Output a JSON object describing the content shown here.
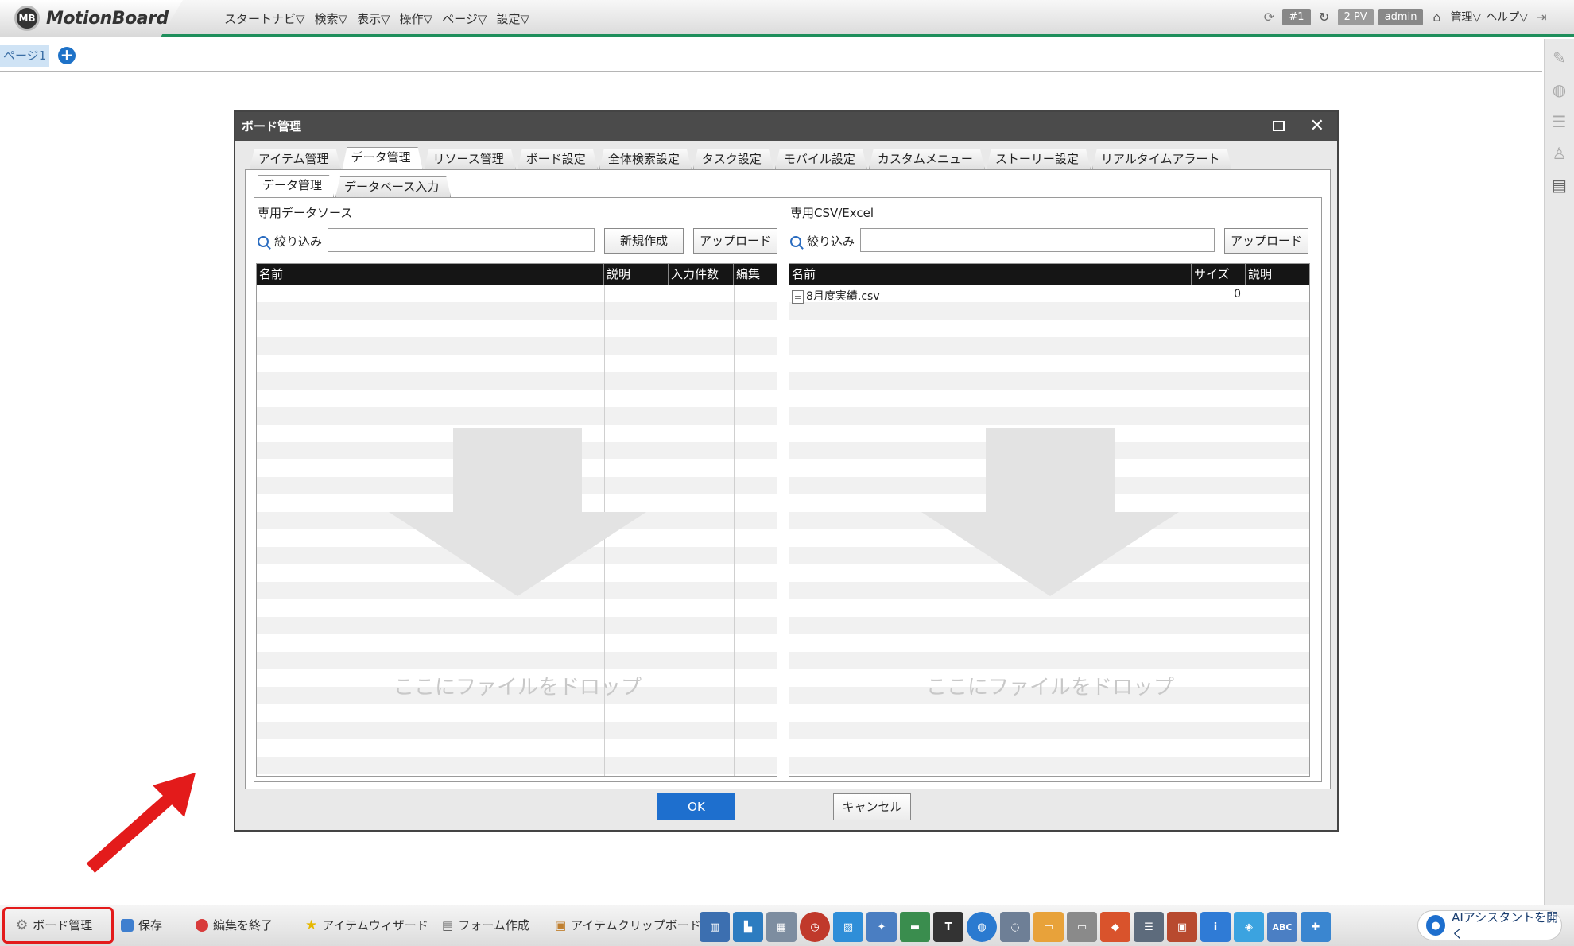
{
  "app": {
    "logo_mark": "MB",
    "logo_text": "MotionBoard"
  },
  "topmenu": [
    {
      "label": "スタートナビ▽"
    },
    {
      "label": "検索▽"
    },
    {
      "label": "表示▽"
    },
    {
      "label": "操作▽"
    },
    {
      "label": "ページ▽"
    },
    {
      "label": "設定▽"
    }
  ],
  "topright": {
    "board_no": "#1",
    "pv": "2 PV",
    "user": "admin",
    "admin_menu": "管理▽",
    "help_menu": "ヘルプ▽"
  },
  "pagebar": {
    "tab": "ページ1",
    "add": "+"
  },
  "dialog": {
    "title": "ボード管理",
    "close": "✕",
    "tabs": [
      "アイテム管理",
      "データ管理",
      "リソース管理",
      "ボード設定",
      "全体検索設定",
      "タスク設定",
      "モバイル設定",
      "カスタムメニュー",
      "ストーリー設定",
      "リアルタイムアラート"
    ],
    "subtabs": [
      "データ管理",
      "データベース入力"
    ],
    "left": {
      "title": "専用データソース",
      "filter_label": "絞り込み",
      "filter_value": "",
      "new_button": "新規作成",
      "upload_button": "アップロード",
      "columns": [
        "名前",
        "説明",
        "入力件数",
        "編集"
      ],
      "rows": [],
      "drop_text": "ここにファイルをドロップ"
    },
    "right": {
      "title": "専用CSV/Excel",
      "filter_label": "絞り込み",
      "filter_value": "",
      "upload_button": "アップロード",
      "columns": [
        "名前",
        "サイズ",
        "説明"
      ],
      "rows": [
        {
          "name": "8月度実績.csv",
          "size": "0",
          "description": ""
        }
      ],
      "drop_text": "ここにファイルをドロップ"
    },
    "ok": "OK",
    "cancel": "キャンセル"
  },
  "bottombar": {
    "items": [
      "ボード管理",
      "保存",
      "編集を終了",
      "アイテムウィザード",
      "フォーム作成",
      "アイテムクリップボード"
    ],
    "palette": [
      "layout",
      "chart",
      "grid",
      "clock",
      "image",
      "network",
      "label-bar",
      "T",
      "globe",
      "speech",
      "folder",
      "button",
      "shapes",
      "list",
      "window",
      "info",
      "cube",
      "ABC",
      "puzzle"
    ],
    "ai_button": "AIアシスタントを開く"
  },
  "colors": {
    "accent_green": "#1f8f5c",
    "primary_blue": "#1e6fce",
    "highlight_red": "#e31b1b"
  }
}
